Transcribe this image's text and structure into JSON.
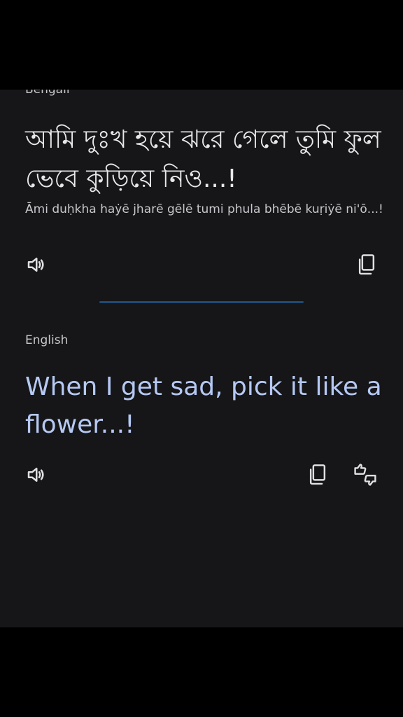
{
  "source": {
    "language": "Bengali",
    "text": "আমি দুঃখ হয়ে ঝরে গেলে তুমি ফুল ভেবে কুড়িয়ে নিও...!",
    "transliteration": "Āmi duḥkha haẏē jharē gēlē tumi phula bhēbē kuṛiẏē ni'ō...!"
  },
  "target": {
    "language": "English",
    "text": "When I get sad, pick it like a flower...!"
  },
  "icons": {
    "listen": "speaker-icon",
    "copy": "copy-icon",
    "feedback": "thumbs-feedback-icon"
  },
  "colors": {
    "panel_bg": "#161618",
    "translation_text": "#b6c9f4",
    "divider": "#1f4a73"
  }
}
